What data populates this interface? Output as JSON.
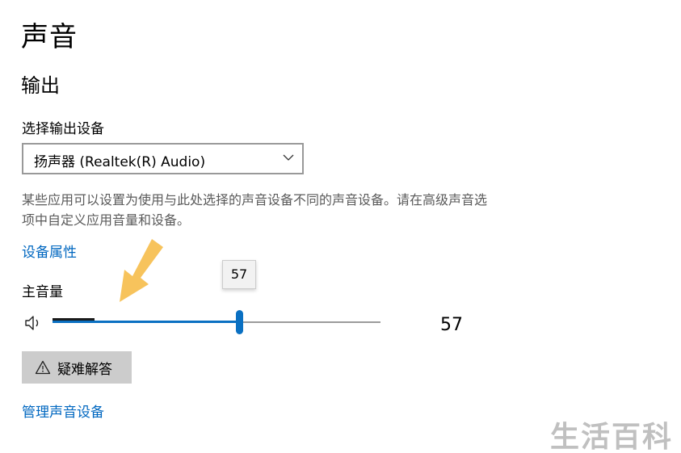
{
  "page": {
    "title": "声音"
  },
  "output": {
    "section_title": "输出",
    "select_label": "选择输出设备",
    "selected_device": "扬声器 (Realtek(R) Audio)",
    "description": "某些应用可以设置为使用与此处选择的声音设备不同的声音设备。请在高级声音选项中自定义应用音量和设备。",
    "device_properties_link": "设备属性",
    "master_volume_label": "主音量",
    "volume_tooltip": "57",
    "volume_value": "57",
    "volume_level": 57,
    "volume_max": 100,
    "troubleshoot_label": "疑难解答",
    "manage_devices_link": "管理声音设备"
  },
  "annotation": {
    "arrow_color": "#f7c35c"
  },
  "watermark": "生活百科",
  "colors": {
    "accent": "#0a70c2",
    "link": "#0067c0",
    "button_bg": "#cccccc"
  }
}
